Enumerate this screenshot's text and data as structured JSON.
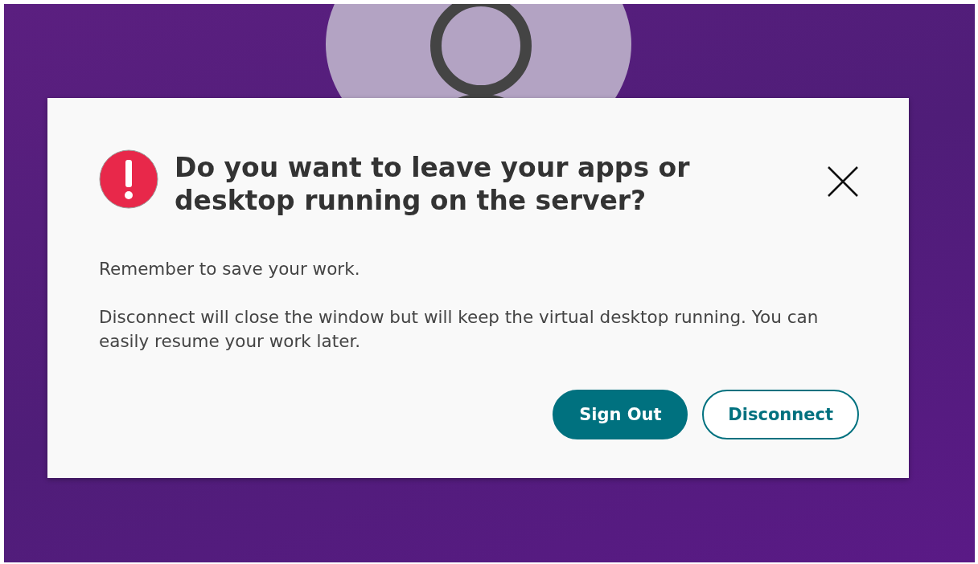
{
  "dialog": {
    "title": "Do you want to leave your apps or desktop running on the server?",
    "paragraphs": [
      "Remember to save your work.",
      "Disconnect will close the window but will keep the virtual desktop running. You can easily resume your work later."
    ],
    "buttons": [
      {
        "label": "Sign Out",
        "kind": "primary"
      },
      {
        "label": "Disconnect",
        "kind": "secondary"
      }
    ]
  }
}
